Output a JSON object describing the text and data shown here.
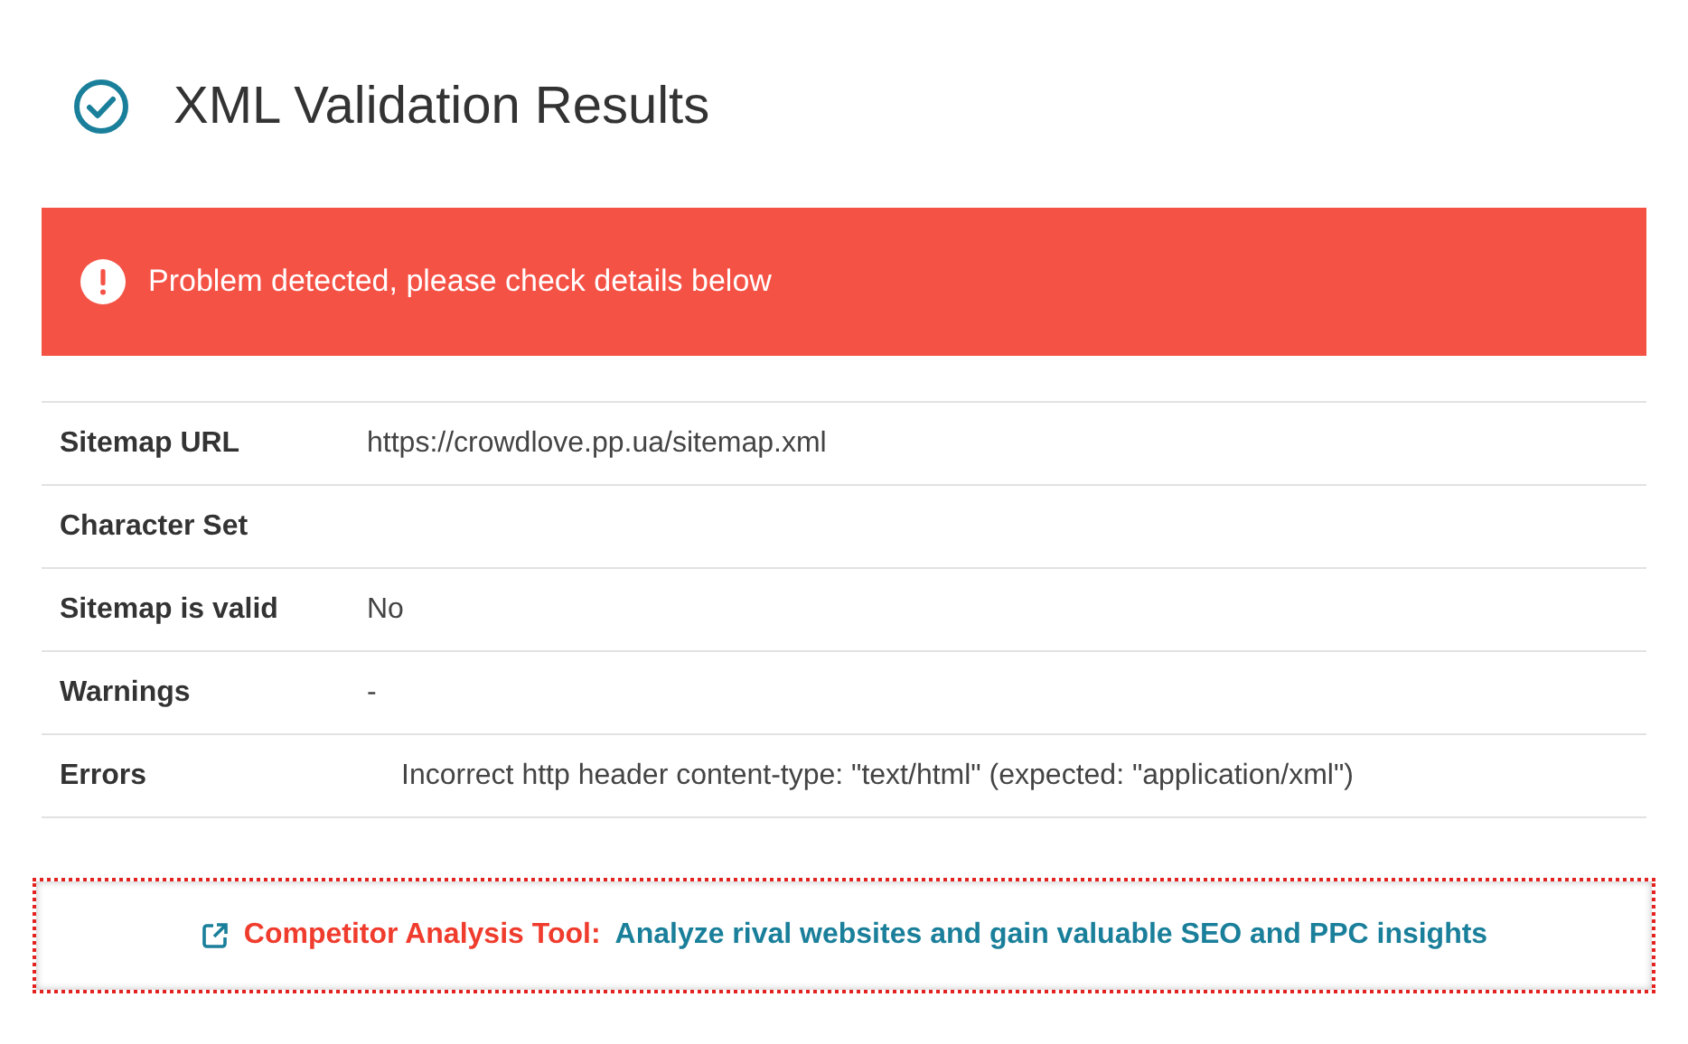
{
  "header": {
    "title": "XML Validation Results"
  },
  "alert": {
    "message": "Problem detected, please check details below"
  },
  "details": [
    {
      "kind": "text",
      "label": "Sitemap URL",
      "value": "https://crowdlove.pp.ua/sitemap.xml"
    },
    {
      "kind": "text",
      "label": "Character Set"
    },
    {
      "kind": "text",
      "label": "Sitemap is valid",
      "value": "No"
    },
    {
      "kind": "text",
      "label": "Warnings",
      "value": "-"
    },
    {
      "kind": "list",
      "label": "Errors",
      "value": "Incorrect http header content-type: \"text/html\" (expected: \"application/xml\")"
    }
  ],
  "promo": {
    "lead": "Competitor Analysis Tool:",
    "link": "Analyze rival websites and gain valuable SEO and PPC insights"
  }
}
